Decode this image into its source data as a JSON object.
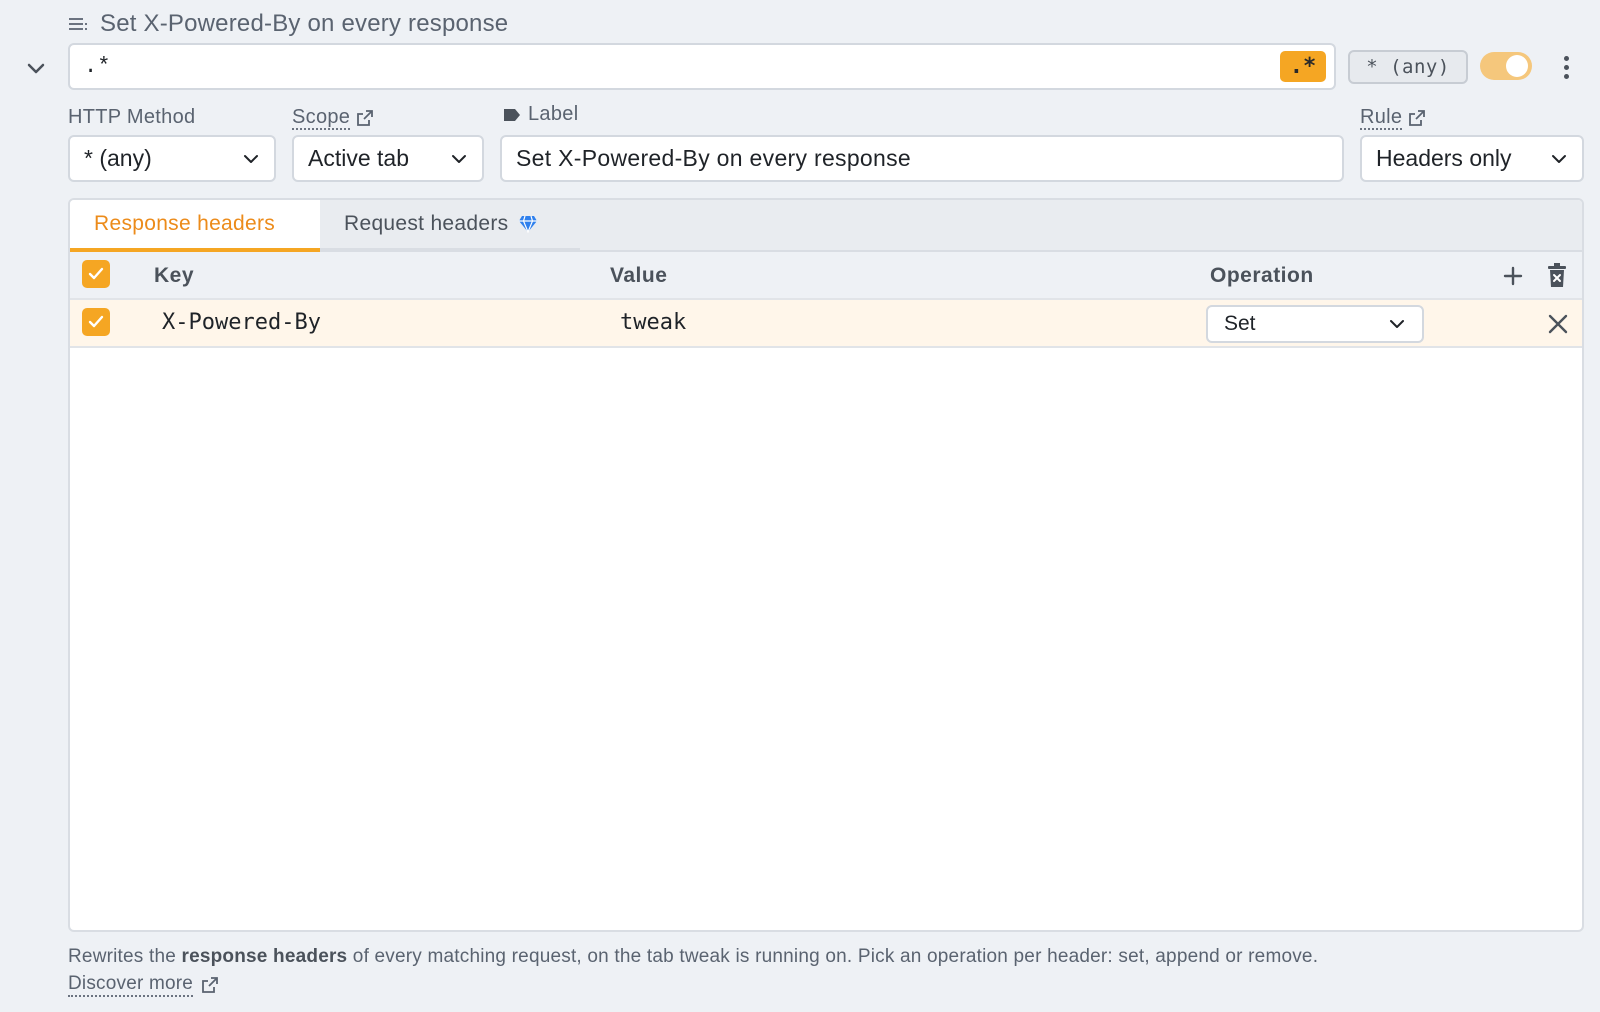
{
  "rule": {
    "title": "Set X-Powered-By on every response",
    "pattern_value": ".*",
    "regex_badge": ".*",
    "method_chip": "* (any)",
    "enabled": true
  },
  "fields": {
    "http_method_label": "HTTP Method",
    "http_method_value": "* (any)",
    "scope_label": "Scope",
    "scope_value": "Active tab",
    "label_label": "Label",
    "label_value": "Set X-Powered-By on every response",
    "rule_label": "Rule",
    "rule_value": "Headers only"
  },
  "tabs": [
    {
      "label": "Response headers",
      "active": true
    },
    {
      "label": "Request headers",
      "active": false
    }
  ],
  "table": {
    "columns": [
      "Key",
      "Value",
      "Operation"
    ],
    "rows": [
      {
        "checked": true,
        "key": "X-Powered-By",
        "value": "tweak",
        "operation": "Set"
      }
    ]
  },
  "footer": {
    "text_before": "Rewrites the ",
    "bold": "response headers",
    "text_after": " of every matching request, on the tab tweak is running on. Pick an operation per header: set, append or remove.",
    "link": "Discover more"
  },
  "colors": {
    "accent": "#f5a623",
    "accent_text": "#ec8b1a",
    "row_highlight": "#fff6ea",
    "background": "#eef1f5",
    "premium_icon": "#2f80ed"
  },
  "icons": [
    "lines-icon",
    "chevron-down-icon",
    "external-link-icon",
    "tag-icon",
    "gem-icon",
    "check-icon",
    "plus-icon",
    "trash-icon",
    "close-icon",
    "kebab-icon"
  ]
}
